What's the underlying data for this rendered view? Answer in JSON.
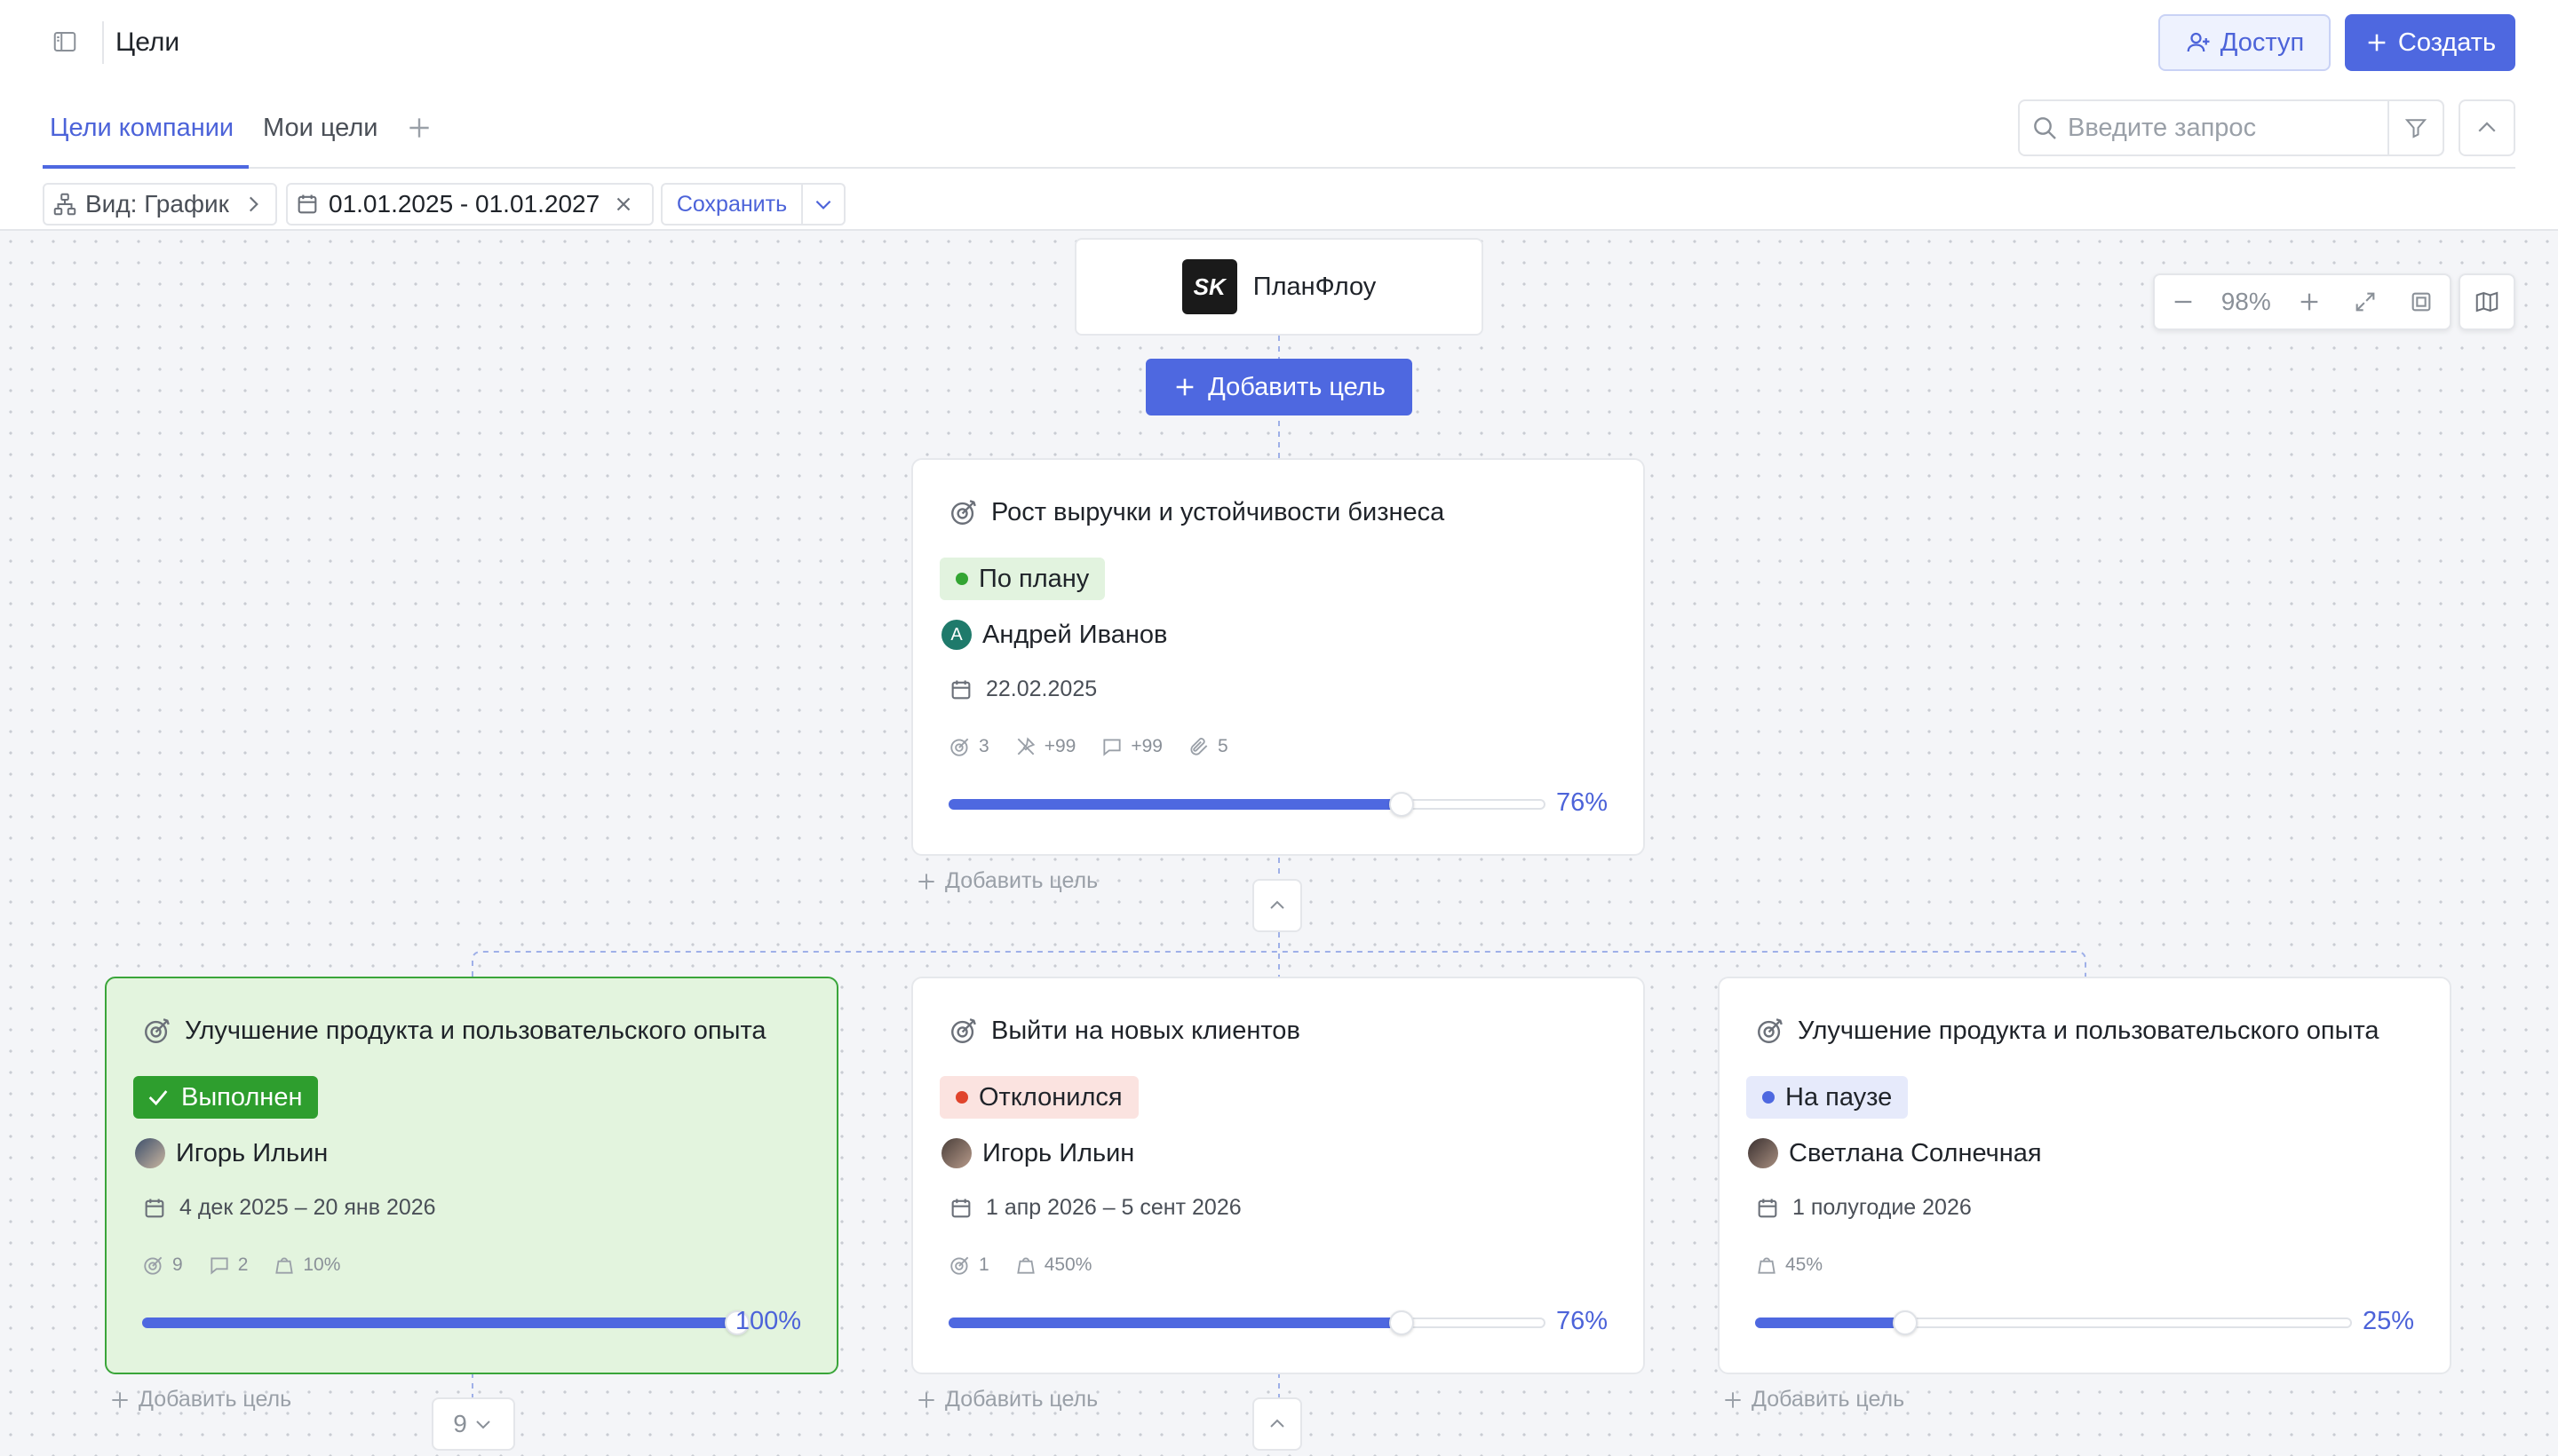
{
  "header": {
    "title": "Цели",
    "access_label": "Доступ",
    "create_label": "Создать"
  },
  "tabs": [
    {
      "label": "Цели компании"
    },
    {
      "label": "Мои цели"
    }
  ],
  "search": {
    "placeholder": "Введите запрос"
  },
  "toolbar": {
    "view_label": "Вид: График",
    "date_range": "01.01.2025 - 01.01.2027",
    "save_label": "Сохранить"
  },
  "zoom": {
    "value": "98%"
  },
  "root": {
    "name": "ПланФлоу",
    "logo_text": "SK",
    "add_goal_label": "Добавить цель"
  },
  "colors": {
    "accent": "#4e68e0",
    "on_plan": "#33a533",
    "deviated": "#e0442c",
    "paused": "#4e68e0",
    "done": "#2e9e2e"
  },
  "cards": [
    {
      "title": "Рост выручки и устойчивости бизнеса",
      "status": "По плану",
      "owner": "Андрей Иванов",
      "owner_initial": "А",
      "date": "22.02.2025",
      "stats": [
        "3",
        "+99",
        "+99",
        "5"
      ],
      "progress": 76,
      "progress_label": "76%",
      "add_label": "Добавить цель"
    },
    {
      "title": "Улучшение продукта и пользовательского опыта",
      "status": "Выполнен",
      "owner": "Игорь Ильин",
      "date": "4 дек 2025 – 20 янв 2026",
      "stats": [
        "9",
        "2",
        "10%"
      ],
      "progress": 100,
      "progress_label": "100%",
      "add_label": "Добавить цель",
      "children_count": "9"
    },
    {
      "title": "Выйти на новых клиентов",
      "status": "Отклонился",
      "owner": "Игорь Ильин",
      "date": "1 апр 2026 – 5 сент 2026",
      "stats": [
        "1",
        "450%"
      ],
      "progress": 76,
      "progress_label": "76%",
      "add_label": "Добавить цель"
    },
    {
      "title": "Улучшение продукта и пользовательского опыта",
      "status": "На паузе",
      "owner": "Светлана Солнечная",
      "date": "1 полугодие 2026",
      "stats": [
        "45%"
      ],
      "progress": 25,
      "progress_label": "25%",
      "add_label": "Добавить цель"
    }
  ]
}
